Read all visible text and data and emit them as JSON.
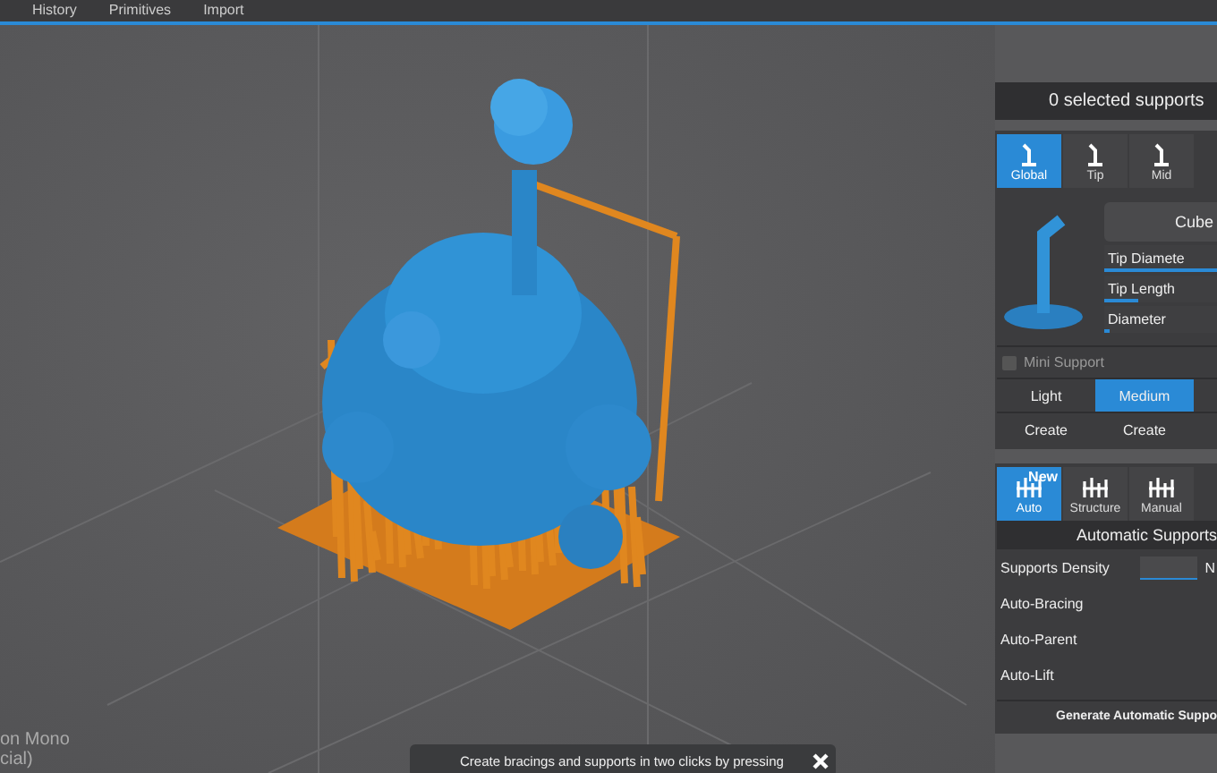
{
  "menu": [
    "History",
    "Primitives",
    "Import"
  ],
  "selection_header": "0 selected supports",
  "support_tabs": [
    {
      "label": "Global",
      "selected": true
    },
    {
      "label": "Tip",
      "selected": false
    },
    {
      "label": "Mid",
      "selected": false
    }
  ],
  "head_preset": "Cube",
  "params": [
    {
      "label": "Tip Diamete",
      "level": 1
    },
    {
      "label": "Tip Length",
      "level": 0.3
    },
    {
      "label": "Diameter",
      "level": 0.04
    }
  ],
  "mini_support": {
    "label": "Mini Support",
    "checked": false
  },
  "density_presets": [
    {
      "label": "Light",
      "selected": false
    },
    {
      "label": "Medium",
      "selected": true
    }
  ],
  "create_buttons": [
    "Create",
    "Create"
  ],
  "mode_tabs": [
    {
      "label": "Auto",
      "selected": true,
      "badge": "New"
    },
    {
      "label": "Structure",
      "selected": false
    },
    {
      "label": "Manual",
      "selected": false
    }
  ],
  "auto_section": {
    "title": "Automatic Supports",
    "settings": [
      {
        "kind": "field",
        "label": "Supports Density",
        "value": "N"
      },
      {
        "kind": "toggle",
        "label": "Auto-Bracing"
      },
      {
        "kind": "toggle",
        "label": "Auto-Parent"
      },
      {
        "kind": "toggle",
        "label": "Auto-Lift"
      }
    ],
    "button": "Generate Automatic Suppo"
  },
  "font_hint": [
    "on Mono",
    "cial)"
  ],
  "tooltip": "Create bracings and supports in two clicks by pressing"
}
